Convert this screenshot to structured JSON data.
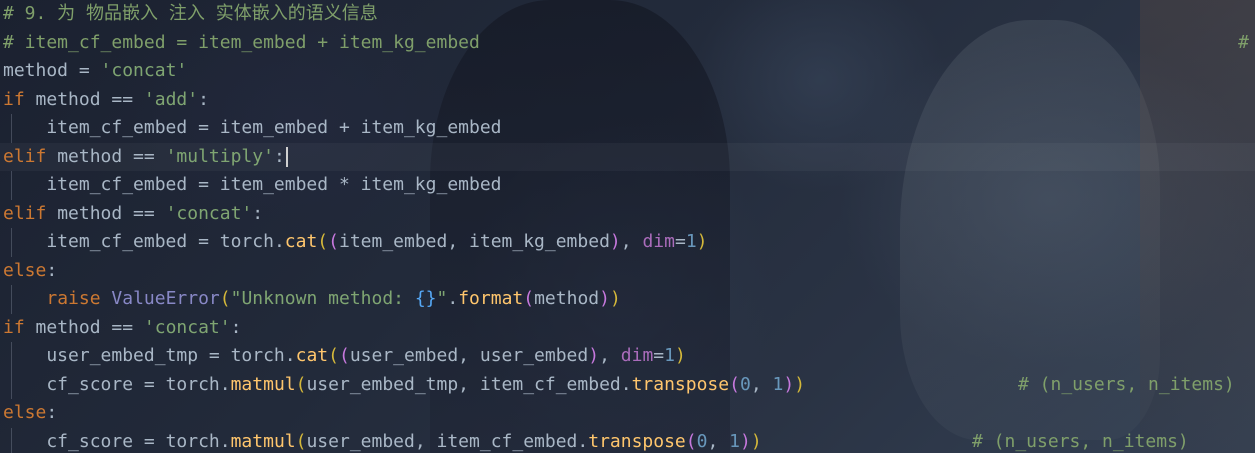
{
  "editor": {
    "language": "python",
    "lines": [
      [
        {
          "t": "# 9. 为 物品嵌入 注入 实体嵌入的语义信息",
          "c": "comment"
        }
      ],
      [
        {
          "t": "# item_cf_embed = item_embed + item_kg_embed",
          "c": "comment"
        }
      ],
      [
        {
          "t": "method",
          "c": "ident"
        },
        {
          "t": " = ",
          "c": "op"
        },
        {
          "t": "'concat'",
          "c": "string"
        }
      ],
      [
        {
          "t": "if",
          "c": "keyword"
        },
        {
          "t": " method == ",
          "c": "ident"
        },
        {
          "t": "'add'",
          "c": "string"
        },
        {
          "t": ":",
          "c": "op"
        }
      ],
      [
        {
          "t": "    item_cf_embed = item_embed + item_kg_embed",
          "c": "ident"
        }
      ],
      [
        {
          "t": "elif",
          "c": "keyword"
        },
        {
          "t": " method == ",
          "c": "ident"
        },
        {
          "t": "'multiply'",
          "c": "string"
        },
        {
          "t": ":",
          "c": "op"
        }
      ],
      [
        {
          "t": "    item_cf_embed = item_embed * item_kg_embed",
          "c": "ident"
        }
      ],
      [
        {
          "t": "elif",
          "c": "keyword"
        },
        {
          "t": " method == ",
          "c": "ident"
        },
        {
          "t": "'concat'",
          "c": "string"
        },
        {
          "t": ":",
          "c": "op"
        }
      ],
      [
        {
          "t": "    item_cf_embed = ",
          "c": "ident"
        },
        {
          "t": "torch",
          "c": "module"
        },
        {
          "t": ".",
          "c": "op"
        },
        {
          "t": "cat",
          "c": "func"
        },
        {
          "t": "(",
          "c": "paren"
        },
        {
          "t": "(",
          "c": "paren2"
        },
        {
          "t": "item_embed, item_kg_embed",
          "c": "ident"
        },
        {
          "t": ")",
          "c": "paren2"
        },
        {
          "t": ", ",
          "c": "op"
        },
        {
          "t": "dim",
          "c": "param"
        },
        {
          "t": "=",
          "c": "op"
        },
        {
          "t": "1",
          "c": "number"
        },
        {
          "t": ")",
          "c": "paren"
        }
      ],
      [
        {
          "t": "else",
          "c": "keyword"
        },
        {
          "t": ":",
          "c": "op"
        }
      ],
      [
        {
          "t": "    ",
          "c": "ident"
        },
        {
          "t": "raise",
          "c": "keyword"
        },
        {
          "t": " ",
          "c": "ident"
        },
        {
          "t": "ValueError",
          "c": "builtin"
        },
        {
          "t": "(",
          "c": "paren"
        },
        {
          "t": "\"Unknown method: ",
          "c": "string"
        },
        {
          "t": "{}",
          "c": "brace"
        },
        {
          "t": "\"",
          "c": "string"
        },
        {
          "t": ".",
          "c": "op"
        },
        {
          "t": "format",
          "c": "func"
        },
        {
          "t": "(",
          "c": "paren2"
        },
        {
          "t": "method",
          "c": "ident"
        },
        {
          "t": ")",
          "c": "paren2"
        },
        {
          "t": ")",
          "c": "paren"
        }
      ],
      [
        {
          "t": "if",
          "c": "keyword"
        },
        {
          "t": " method == ",
          "c": "ident"
        },
        {
          "t": "'concat'",
          "c": "string"
        },
        {
          "t": ":",
          "c": "op"
        }
      ],
      [
        {
          "t": "    user_embed_tmp = ",
          "c": "ident"
        },
        {
          "t": "torch",
          "c": "module"
        },
        {
          "t": ".",
          "c": "op"
        },
        {
          "t": "cat",
          "c": "func"
        },
        {
          "t": "(",
          "c": "paren"
        },
        {
          "t": "(",
          "c": "paren2"
        },
        {
          "t": "user_embed, user_embed",
          "c": "ident"
        },
        {
          "t": ")",
          "c": "paren2"
        },
        {
          "t": ", ",
          "c": "op"
        },
        {
          "t": "dim",
          "c": "param"
        },
        {
          "t": "=",
          "c": "op"
        },
        {
          "t": "1",
          "c": "number"
        },
        {
          "t": ")",
          "c": "paren"
        }
      ],
      [
        {
          "t": "    cf_score = ",
          "c": "ident"
        },
        {
          "t": "torch",
          "c": "module"
        },
        {
          "t": ".",
          "c": "op"
        },
        {
          "t": "matmul",
          "c": "func"
        },
        {
          "t": "(",
          "c": "paren"
        },
        {
          "t": "user_embed_tmp, item_cf_embed.",
          "c": "ident"
        },
        {
          "t": "transpose",
          "c": "func"
        },
        {
          "t": "(",
          "c": "paren2"
        },
        {
          "t": "0",
          "c": "number"
        },
        {
          "t": ", ",
          "c": "op"
        },
        {
          "t": "1",
          "c": "number"
        },
        {
          "t": ")",
          "c": "paren2"
        },
        {
          "t": ")",
          "c": "paren"
        }
      ],
      [
        {
          "t": "else",
          "c": "keyword"
        },
        {
          "t": ":",
          "c": "op"
        }
      ],
      [
        {
          "t": "    cf_score = ",
          "c": "ident"
        },
        {
          "t": "torch",
          "c": "module"
        },
        {
          "t": ".",
          "c": "op"
        },
        {
          "t": "matmul",
          "c": "func"
        },
        {
          "t": "(",
          "c": "paren"
        },
        {
          "t": "user_embed, item_cf_embed.",
          "c": "ident"
        },
        {
          "t": "transpose",
          "c": "func"
        },
        {
          "t": "(",
          "c": "paren2"
        },
        {
          "t": "0",
          "c": "number"
        },
        {
          "t": ", ",
          "c": "op"
        },
        {
          "t": "1",
          "c": "number"
        },
        {
          "t": ")",
          "c": "paren2"
        },
        {
          "t": ")",
          "c": "paren"
        }
      ]
    ],
    "trailing_comments": {
      "line_1": "#",
      "line_13": "# (n_users, n_items)",
      "line_15": "# (n_users, n_items)"
    },
    "current_line": 5,
    "indented_lines": [
      4,
      6,
      8,
      10,
      12,
      13,
      15
    ]
  }
}
